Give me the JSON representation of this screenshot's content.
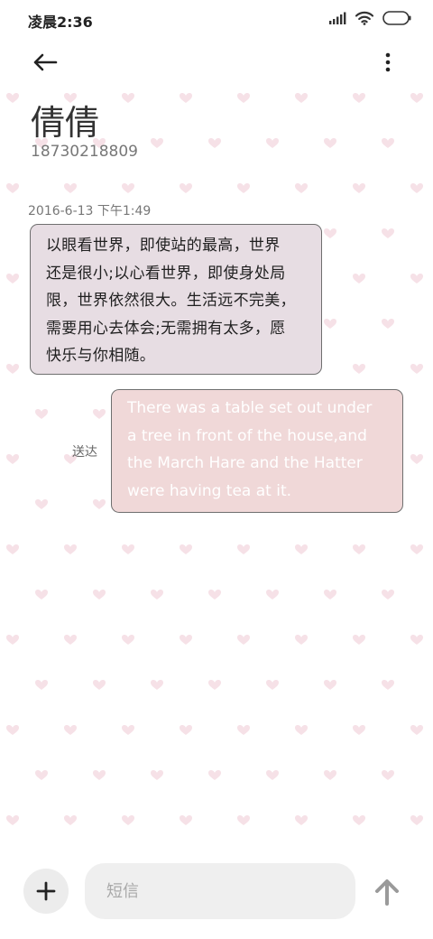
{
  "status_bar": {
    "time": "凌晨2:36",
    "icons": [
      "signal-icon",
      "wifi-icon",
      "battery-icon"
    ]
  },
  "toolbar": {
    "back_icon": "arrow-left-icon",
    "more_icon": "more-vertical-icon"
  },
  "contact": {
    "name": "倩倩",
    "number": "18730218809"
  },
  "conversation": {
    "timestamp": "2016-6-13 下午1:49",
    "incoming": {
      "lines": [
        "以眼看世界，即使站的最高，世界",
        "还是很小;以心看世界，即使身处局",
        "限，世界依然很大。生活远不完美，",
        "需要用心去体会;无需拥有太多，愿",
        "快乐与你相随。"
      ]
    },
    "outgoing": {
      "status": "送达",
      "lines": [
        "There was a table set out under",
        "a tree in front of the house,and",
        "the March Hare and the Hatter",
        "were having tea at it."
      ]
    }
  },
  "composer": {
    "placeholder": "短信",
    "add_icon": "plus-icon",
    "send_icon": "send-arrow-up-icon"
  },
  "colors": {
    "incoming_bubble": "#e7dde3",
    "outgoing_bubble": "#f0d8d8",
    "heart_pattern": "#f6e1e7"
  }
}
